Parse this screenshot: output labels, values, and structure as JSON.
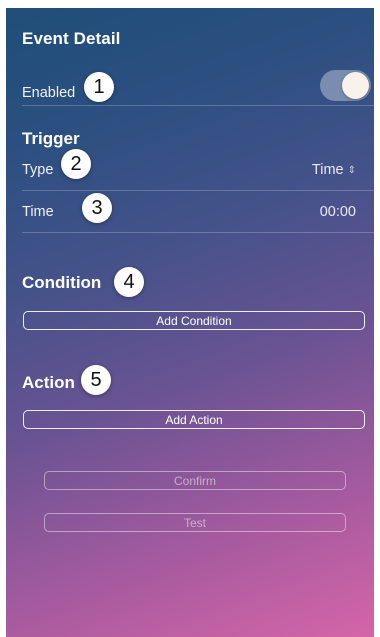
{
  "header": {
    "title": "Event Detail"
  },
  "enabled_row": {
    "label": "Enabled",
    "toggle_on": true,
    "badge": "1"
  },
  "trigger": {
    "section_title": "Trigger",
    "type_label": "Type",
    "type_value": "Time",
    "type_badge": "2",
    "time_label": "Time",
    "time_value": "00:00",
    "time_badge": "3"
  },
  "condition": {
    "section_title": "Condition",
    "badge": "4",
    "add_button": "Add Condition"
  },
  "action": {
    "section_title": "Action",
    "badge": "5",
    "add_button": "Add Action"
  },
  "footer": {
    "confirm_button": "Confirm",
    "test_button": "Test"
  },
  "colors": {
    "gradient_start": "#1f4e78",
    "gradient_end": "#d565a8",
    "badge_bg": "#ffffff",
    "toggle_knob": "#f7f3ea"
  },
  "icons": {
    "type_selector": "chevron-up-down-icon"
  }
}
